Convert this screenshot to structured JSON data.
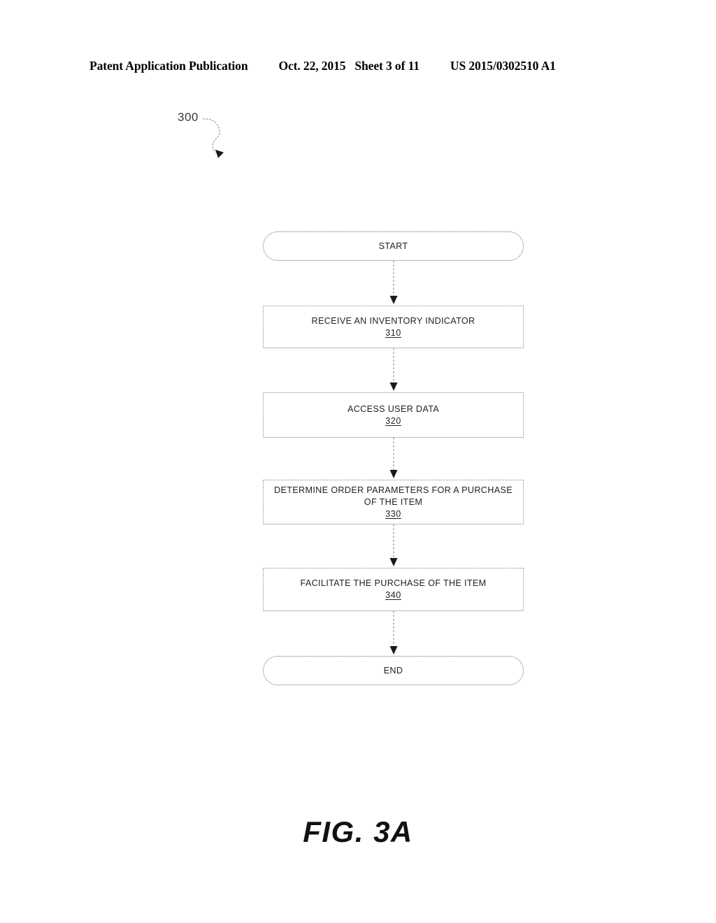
{
  "header": {
    "publication": "Patent Application Publication",
    "date": "Oct. 22, 2015",
    "sheet": "Sheet 3 of 11",
    "patent_number": "US 2015/0302510 A1"
  },
  "figure": {
    "reference_numeral": "300",
    "caption": "FIG. 3A"
  },
  "chart_data": {
    "type": "flowchart",
    "title": "FIG. 3A",
    "reference_numeral": "300",
    "orientation": "vertical",
    "nodes": [
      {
        "id": "start",
        "shape": "terminal",
        "lines": [
          "START"
        ],
        "ref": ""
      },
      {
        "id": "step310",
        "shape": "process",
        "lines": [
          "RECEIVE AN INVENTORY INDICATOR"
        ],
        "ref": "310"
      },
      {
        "id": "step320",
        "shape": "process",
        "lines": [
          "ACCESS USER DATA"
        ],
        "ref": "320"
      },
      {
        "id": "step330",
        "shape": "process",
        "lines": [
          "DETERMINE ORDER PARAMETERS FOR A PURCHASE",
          "OF THE ITEM"
        ],
        "ref": "330"
      },
      {
        "id": "step340",
        "shape": "process",
        "lines": [
          "FACILITATE THE PURCHASE OF THE ITEM"
        ],
        "ref": "340"
      },
      {
        "id": "end",
        "shape": "terminal",
        "lines": [
          "END"
        ],
        "ref": ""
      }
    ],
    "edges": [
      {
        "from": "start",
        "to": "step310",
        "style": "dotted",
        "arrow": "down"
      },
      {
        "from": "step310",
        "to": "step320",
        "style": "dotted",
        "arrow": "down"
      },
      {
        "from": "step320",
        "to": "step330",
        "style": "dotted",
        "arrow": "down"
      },
      {
        "from": "step330",
        "to": "step340",
        "style": "dotted",
        "arrow": "down"
      },
      {
        "from": "step340",
        "to": "end",
        "style": "dotted",
        "arrow": "down"
      }
    ]
  },
  "nodes": {
    "start": {
      "label": "START"
    },
    "step310": {
      "line1": "RECEIVE AN INVENTORY INDICATOR",
      "ref": "310"
    },
    "step320": {
      "line1": "ACCESS USER DATA",
      "ref": "320"
    },
    "step330": {
      "line1": "DETERMINE ORDER PARAMETERS FOR A PURCHASE",
      "line2": "OF THE ITEM",
      "ref": "330"
    },
    "step340": {
      "line1": "FACILITATE THE PURCHASE OF THE ITEM",
      "ref": "340"
    },
    "end": {
      "label": "END"
    }
  },
  "colors": {
    "ink": "#000000",
    "line": "#8a8a8a",
    "text": "#222222"
  }
}
